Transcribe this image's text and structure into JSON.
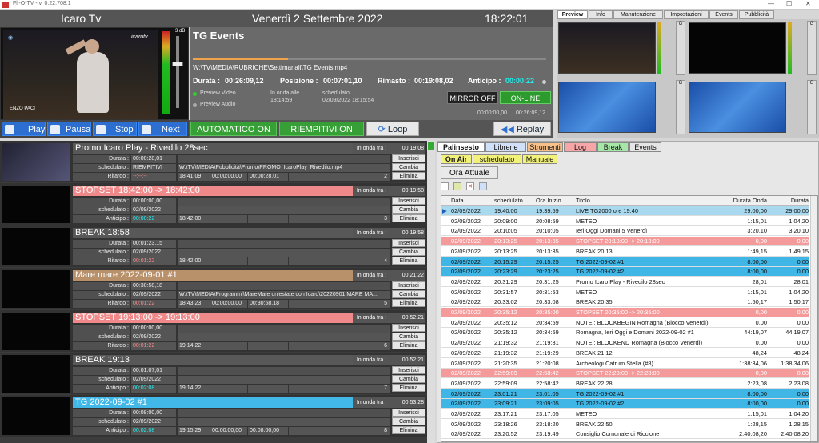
{
  "window": {
    "title": "Fli-O-TV - v. 0.22.708.1",
    "minimize": "—",
    "maximize": "☐",
    "close": "✕"
  },
  "header": {
    "station": "Icaro Tv",
    "date": "Venerdì 2 Settembre 2022",
    "clock": "18:22:01"
  },
  "preview": {
    "logo": "icarotv",
    "caption": "ENZO PACI",
    "db": "3 dB"
  },
  "now_playing": {
    "title": "TG Events",
    "path": "W:\\TV\\MEDIA\\RUBRICHE\\Settimanali\\TG Events.mp4",
    "progress_pct": 27,
    "durata_label": "Durata :",
    "durata": "00:26:09,12",
    "posizione_label": "Posizione :",
    "posizione": "00:07:01,10",
    "rimasto_label": "Rimasto :",
    "rimasto": "00:19:08,02",
    "anticipo_label": "Anticipo :",
    "anticipo": "00:00:22",
    "preview_video": "Preview Video",
    "preview_audio": "Preview Audio",
    "in_onda_label": "In onda alle",
    "in_onda_time": "18:14:59",
    "sched_label": "schedulato",
    "sched_value": "02/09/2022 18:15:54",
    "mirror": "MIRROR OFF",
    "online": "ON-LINE",
    "t1": "00:00:00,00",
    "t2": "00:26:09,12"
  },
  "controls": {
    "play": "Play",
    "pausa": "Pausa",
    "stop": "Stop",
    "next": "Next"
  },
  "modes": {
    "auto": "AUTOMATICO ON",
    "riempitivi": "RIEMPITIVI ON",
    "loop": "Loop",
    "replay": "Replay"
  },
  "right_tabs": [
    "Preview",
    "Info",
    "Manutenzione",
    "Impostazioni",
    "Events",
    "Pubblicità"
  ],
  "monitor_labels": {
    "g1": "G",
    "p1": "Preview",
    "g2": "G",
    "p2": "Preview",
    "db": "3"
  },
  "queue": [
    {
      "title": "Promo Icaro Play - Rivedilo 28sec",
      "ond_label": "In onda tra :",
      "ond": "00:19:08",
      "hdr_color": "#585858",
      "durata_l": "Durata :",
      "durata": "00:00:28,01",
      "sched_l": "schedulato :",
      "sched": "RIEMPITIVI",
      "path": "W:\\TV\\MEDIA\\Pubblicità\\Promo\\PROMO_IcaroPlay_Rivedilo.mp4",
      "rit_l": "Ritardo :",
      "rit": "--:--:--",
      "t_a": "18:41:09",
      "t_b": "00:00:00,00",
      "t_c": "00:00:28,01",
      "num": "2",
      "thumb": true
    },
    {
      "title": "STOPSET 18:42:00 -> 18:42:00",
      "ond_label": "In onda tra :",
      "ond": "00:19:58",
      "hdr_color": "#f08a8a",
      "durata_l": "Durata :",
      "durata": "00:00:00,00",
      "sched_l": "schedulato :",
      "sched": "02/09/2022 18:42:04",
      "path": "",
      "rit_l": "Anticipo :",
      "rit": "00:00:22",
      "t_a": "18:42:00",
      "t_b": "",
      "t_c": "",
      "num": "3",
      "thumb": false
    },
    {
      "title": "BREAK 18:58",
      "ond_label": "In onda tra :",
      "ond": "00:19:58",
      "hdr_color": "#585858",
      "durata_l": "Durata :",
      "durata": "00:01:23,15",
      "sched_l": "schedulato :",
      "sched": "02/09/2022 18:42:04",
      "path": "",
      "rit_l": "Ritardo :",
      "rit": "00:01:22",
      "t_a": "18:42:00",
      "t_b": "",
      "t_c": "",
      "num": "4",
      "thumb": false
    },
    {
      "title": "Mare mare 2022-09-01 #1",
      "ond_label": "In onda tra :",
      "ond": "00:21:22",
      "hdr_color": "#b8906a",
      "durata_l": "Durata :",
      "durata": "00:30:58,18",
      "sched_l": "schedulato :",
      "sched": "02/09/2022 18:43:47",
      "path": "W:\\TV\\MEDIA\\Programmi\\MareMare un'estate con Icaro\\20220901 MARE MA...",
      "rit_l": "Ritardo :",
      "rit": "00:01:22",
      "t_a": "18:43:23",
      "t_b": "00:00:00,00",
      "t_c": "00:30:58,18",
      "num": "5",
      "thumb": false
    },
    {
      "title": "STOPSET 19:13:00 -> 19:13:00",
      "ond_label": "In onda tra :",
      "ond": "00:52:21",
      "hdr_color": "#f08a8a",
      "durata_l": "Durata :",
      "durata": "00:00:00,00",
      "sched_l": "schedulato :",
      "sched": "02/09/2022 19:14:45",
      "path": "",
      "rit_l": "Ritardo :",
      "rit": "00:01:22",
      "t_a": "19:14:22",
      "t_b": "",
      "t_c": "",
      "num": "6",
      "thumb": false
    },
    {
      "title": "BREAK 19:13",
      "ond_label": "In onda tra :",
      "ond": "00:52:21",
      "hdr_color": "#585858",
      "durata_l": "Durata :",
      "durata": "00:01:07,01",
      "sched_l": "schedulato :",
      "sched": "02/09/2022 19:14:45",
      "path": "",
      "rit_l": "Anticipo :",
      "rit": "00:02:08",
      "t_a": "19:14:22",
      "t_b": "",
      "t_c": "",
      "num": "7",
      "thumb": false
    },
    {
      "title": "TG 2022-09-02 #1",
      "ond_label": "In onda tra :",
      "ond": "00:53:28",
      "hdr_color": "#42b8e8",
      "durata_l": "Durata :",
      "durata": "00:08:00,00",
      "sched_l": "schedulato :",
      "sched": "02/09/2022 19:16:50",
      "path": "",
      "rit_l": "Anticipo :",
      "rit": "00:02:08",
      "t_a": "19:15:29",
      "t_b": "00:00:00,00",
      "t_c": "00:08:00,00",
      "num": "8",
      "thumb": false
    }
  ],
  "queue_buttons": {
    "ins": "Inserisci",
    "cam": "Cambia",
    "eli": "Elimina"
  },
  "panel_tabs": [
    {
      "label": "Palinsesto",
      "bg": "#ffffff"
    },
    {
      "label": "Librerie",
      "bg": "#cfe0f8"
    },
    {
      "label": "Strumenti",
      "bg": "#f6c08a"
    },
    {
      "label": "Log",
      "bg": "#f6a6a6"
    },
    {
      "label": "Break",
      "bg": "#a6e6a6"
    },
    {
      "label": "Events",
      "bg": "#e5e5e5"
    }
  ],
  "sub_tabs": [
    {
      "label": "On Air",
      "bg": "#f2f27a"
    },
    {
      "label": "schedulato",
      "bg": "#f2f27a"
    },
    {
      "label": "Manuale",
      "bg": "#f2f27a"
    }
  ],
  "ora_attuale": "Ora Attuale",
  "grid": {
    "headers": [
      "Data",
      "schedulato",
      "Ora Inizio",
      "Titolo",
      "Durata Onda",
      "Durata"
    ],
    "rows": [
      [
        "02/09/2022",
        "19:40:00",
        "19:39:59",
        "LIVE  TG2000 ore 19:40",
        "29:00,00",
        "29:00,00",
        "sel"
      ],
      [
        "02/09/2022",
        "20:09:00",
        "20:08:59",
        "METEO",
        "1:15,01",
        "1:04,20",
        ""
      ],
      [
        "02/09/2022",
        "20:10:05",
        "20:10:05",
        "Ieri Oggi Domani 5 Venerdì",
        "3:20,10",
        "3:20,10",
        ""
      ],
      [
        "02/09/2022",
        "20:13:25",
        "20:13:35",
        "STOPSET 20:13:00 -> 20:13:00",
        "0,00",
        "0,00",
        "stop"
      ],
      [
        "02/09/2022",
        "20:13:25",
        "20:13:35",
        "BREAK 20:13",
        "1:49,15",
        "1:49,15",
        ""
      ],
      [
        "02/09/2022",
        "20:15:29",
        "20:15:25",
        "TG 2022-09-02 #1",
        "8:00,00",
        "0,00",
        "tg"
      ],
      [
        "02/09/2022",
        "20:23:29",
        "20:23:25",
        "TG 2022-09-02 #2",
        "8:00,00",
        "0,00",
        "tg"
      ],
      [
        "02/09/2022",
        "20:31:29",
        "20:31:25",
        "Promo Icaro Play - Rivedilo 28sec",
        "28,01",
        "28,01",
        ""
      ],
      [
        "02/09/2022",
        "20:31:57",
        "20:31:53",
        "METEO",
        "1:15,01",
        "1:04,20",
        ""
      ],
      [
        "02/09/2022",
        "20:33:02",
        "20:33:08",
        "BREAK 20:35",
        "1:50,17",
        "1:50,17",
        ""
      ],
      [
        "02/09/2022",
        "20:35:12",
        "20:35:00",
        "STOPSET 20:35:00 -> 20:35:00",
        "0,00",
        "0,00",
        "stop"
      ],
      [
        "02/09/2022",
        "20:35:12",
        "20:34:59",
        "NOTE : BLOCKBEGIN Romagna (Blocco Venerdì)",
        "0,00",
        "0,00",
        ""
      ],
      [
        "02/09/2022",
        "20:35:12",
        "20:34:59",
        "Romagna, Ieri Oggi e Domani 2022-09-02 #1",
        "44:19,07",
        "44:19,07",
        ""
      ],
      [
        "02/09/2022",
        "21:19:32",
        "21:19:31",
        "NOTE : BLOCKEND Romagna (Blocco Venerdì)",
        "0,00",
        "0,00",
        ""
      ],
      [
        "02/09/2022",
        "21:19:32",
        "21:19:29",
        "BREAK 21:12",
        "48,24",
        "48,24",
        ""
      ],
      [
        "02/09/2022",
        "21:20:35",
        "21:20:08",
        "Archeologi Catrum Stella (#8)",
        "1:38:34,06",
        "1:38:34,06",
        ""
      ],
      [
        "02/09/2022",
        "22:59:09",
        "22:58:42",
        "STOPSET 22:28:00 -> 22:28:00",
        "0,00",
        "0,00",
        "stop"
      ],
      [
        "02/09/2022",
        "22:59:09",
        "22:58:42",
        "BREAK 22:28",
        "2:23,08",
        "2:23,08",
        ""
      ],
      [
        "02/09/2022",
        "23:01:21",
        "23:01:05",
        "TG 2022-09-02 #1",
        "8:00,00",
        "0,00",
        "tg"
      ],
      [
        "02/09/2022",
        "23:09:21",
        "23:09:05",
        "TG 2022-09-02 #2",
        "8:00,00",
        "0,00",
        "tg"
      ],
      [
        "02/09/2022",
        "23:17:21",
        "23:17:05",
        "METEO",
        "1:15,01",
        "1:04,20",
        ""
      ],
      [
        "02/09/2022",
        "23:18:26",
        "23:18:20",
        "BREAK 22:50",
        "1:28,15",
        "1:28,15",
        ""
      ],
      [
        "02/09/2022",
        "23:20:52",
        "23:19:49",
        "Consiglio Comunale di Riccione",
        "2:40:08,20",
        "2:40:08,20",
        ""
      ]
    ]
  }
}
